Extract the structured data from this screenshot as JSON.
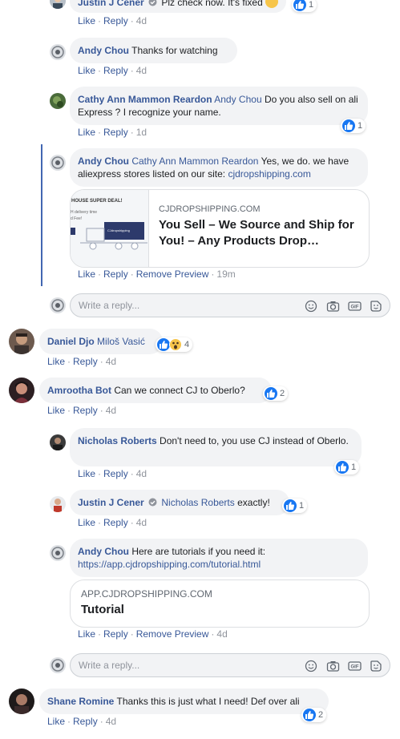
{
  "colors": {
    "link": "#385898",
    "bubble": "#f2f3f5",
    "like": "#1877f2",
    "thread_line": "#4267b2"
  },
  "top": {
    "author": "Justin J Cener",
    "text": "Plz check now. It's fixed",
    "count": "1",
    "actions": {
      "like": "Like",
      "reply": "Reply",
      "time": "4d"
    }
  },
  "c1": {
    "author": "Andy Chou",
    "text": "Thanks for watching",
    "actions": {
      "like": "Like",
      "reply": "Reply",
      "time": "4d"
    }
  },
  "c2": {
    "author": "Cathy Ann Mammon Reardon",
    "mention": "Andy Chou",
    "text": "Do you also sell on ali Express ? I recognize your name.",
    "count": "1",
    "actions": {
      "like": "Like",
      "reply": "Reply",
      "time": "1d"
    }
  },
  "c3": {
    "author": "Andy Chou",
    "mention": "Cathy Ann Mammon Reardon",
    "text": "Yes, we do. we have aliexpress stores listed on our site:",
    "link": "cjdropshipping.com",
    "preview": {
      "domain": "CJDROPSHIPPING.COM",
      "title": "You Sell – We Source and Ship for You! – Any Products Drop…",
      "thumb_banner": "HOUSE SUPER DEAL!",
      "thumb_line1": "H delivery time",
      "thumb_line2": "d Fee!",
      "truck": "CJdropshipping"
    },
    "actions": {
      "like": "Like",
      "reply": "Reply",
      "remove": "Remove Preview",
      "time": "19m"
    }
  },
  "reply1": {
    "placeholder": "Write a reply..."
  },
  "c4": {
    "author": "Daniel Djo",
    "mention": "Miloš Vasić",
    "count": "4",
    "actions": {
      "like": "Like",
      "reply": "Reply",
      "time": "4d"
    }
  },
  "c5": {
    "author": "Amrootha Bot",
    "text": "Can we connect CJ to Oberlo?",
    "count": "2",
    "actions": {
      "like": "Like",
      "reply": "Reply",
      "time": "4d"
    }
  },
  "c6": {
    "author": "Nicholas Roberts",
    "text": "Don't need to, you use CJ instead of Oberlo.",
    "count": "1",
    "actions": {
      "like": "Like",
      "reply": "Reply",
      "time": "4d"
    }
  },
  "c7": {
    "author": "Justin J Cener",
    "mention": "Nicholas Roberts",
    "text": "exactly!",
    "count": "1",
    "actions": {
      "like": "Like",
      "reply": "Reply",
      "time": "4d"
    }
  },
  "c8": {
    "author": "Andy Chou",
    "text": "Here are tutorials if you need it:",
    "link": "https://app.cjdropshipping.com/tutorial.html",
    "preview": {
      "domain": "APP.CJDROPSHIPPING.COM",
      "title": "Tutorial"
    },
    "actions": {
      "like": "Like",
      "reply": "Reply",
      "remove": "Remove Preview",
      "time": "4d"
    }
  },
  "reply2": {
    "placeholder": "Write a reply..."
  },
  "c9": {
    "author": "Shane Romine",
    "text": "Thanks this is just what I need! Def over ali",
    "count": "2",
    "actions": {
      "like": "Like",
      "reply": "Reply",
      "time": "4d"
    }
  },
  "icons": {
    "emoji": "emoji-icon",
    "camera": "camera-icon",
    "gif": "gif-icon",
    "sticker": "sticker-icon",
    "like": "like-icon",
    "wow": "wow-icon",
    "verified": "verified-badge-icon"
  }
}
